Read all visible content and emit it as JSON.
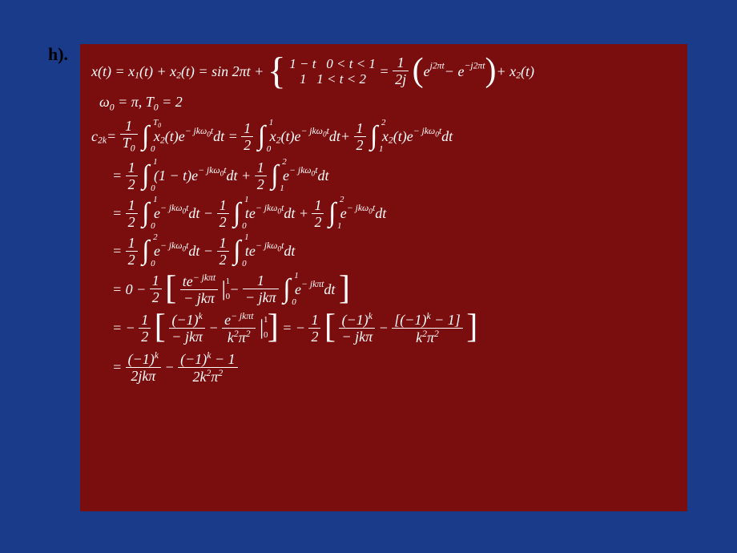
{
  "label": "h).",
  "eq1": {
    "lhs": "x(t) = x",
    "s1": "1",
    "mid1": "(t) + x",
    "s2": "2",
    "mid2": "(t) = sin 2πt +",
    "piece1a": "1 − t",
    "piece1b": "0 < t < 1",
    "piece2a": "1",
    "piece2b": "1 < t < 2",
    "eq": " = ",
    "frac_n": "1",
    "frac_d": "2j",
    "exp1": "j2πt",
    "exp2": "−j2πt",
    "tail": "+ x",
    "tail2": "(t)"
  },
  "line2": {
    "w": "ω",
    "z1": "0",
    "eqp": " = π, T",
    "z2": "0",
    "eq2": " = 2"
  },
  "line3": {
    "c": "c",
    "ck": "2k",
    "eq": " = ",
    "n1": "1",
    "d1": "T",
    "d1s": "0",
    "hi1": "T",
    "hi1s": "0",
    "lo1": "0",
    "x2": "x",
    "x2s": "2",
    "arg": "(t)e",
    "exp": "− jkω",
    "exps": "0",
    "expt": "t",
    "dt": "dt = ",
    "half_n": "1",
    "half_d": "2",
    "hi2": "1",
    "lo2": "0",
    "plus": " + ",
    "hi3": "2",
    "lo3": "1"
  },
  "line4": {
    "eq": "= ",
    "n": "1",
    "d": "2",
    "hi1": "1",
    "lo1": "0",
    "body1a": "(1 − t)e",
    "exp": "− jkω",
    "exps": "0",
    "expt": "t",
    "dt": "dt + ",
    "hi2": "2",
    "lo2": "1",
    "body2": "e",
    "dt2": "dt"
  },
  "line5": {
    "eq": "= ",
    "n": "1",
    "d": "2",
    "hi1": "1",
    "lo1": "0",
    "b1": "e",
    "dt": "dt − ",
    "hi2": "1",
    "lo2": "0",
    "b2": "te",
    "dt2": "dt + ",
    "hi3": "2",
    "lo3": "1",
    "b3": "e",
    "dt3": "dt"
  },
  "line6": {
    "eq": "= ",
    "n": "1",
    "d": "2",
    "hi1": "2",
    "lo1": "0",
    "b1": "e",
    "dt": "dt − ",
    "hi2": "1",
    "lo2": "0",
    "b2": "te",
    "dt2": "dt"
  },
  "line7": {
    "eq": "= 0 − ",
    "n": "1",
    "d": "2",
    "fn1": "te",
    "fe1": "− jkπt",
    "fd1": "− jkπ",
    "ev_hi": "1",
    "ev_lo": "0",
    "minus": " − ",
    "fn2": "1",
    "fd2": "− jkπ",
    "ihi": "1",
    "ilo": "0",
    "b": "e",
    "be": "− jkπt",
    "dt": "dt"
  },
  "line8": {
    "eq": "= − ",
    "n": "1",
    "d": "2",
    "t1n": "(−1)",
    "t1k": "k",
    "t1d": "− jkπ",
    "minus": " − ",
    "t2n": "e",
    "t2e": "− jkπt",
    "t2d": "k",
    "t2d2": "2",
    "t2d3": "π",
    "t2d4": "2",
    "ev_hi": "1",
    "ev_lo": "0",
    "eq2": " = − ",
    "t3n": "(−1)",
    "t3k": "k",
    "t3d": "− jkπ",
    "t4n1": "[(−1)",
    "t4k": "k",
    "t4n2": " − 1]",
    "t4d1": "k",
    "t4d2": "2",
    "t4d3": "π",
    "t4d4": "2"
  },
  "line9": {
    "eq": "= ",
    "n1a": "(−1)",
    "n1k": "k",
    "d1": "2jkπ",
    "minus": " − ",
    "n2a": "(−1)",
    "n2k": "k",
    "n2b": " − 1",
    "d2a": "2k",
    "d2b": "2",
    "d2c": "π",
    "d2d": "2"
  }
}
